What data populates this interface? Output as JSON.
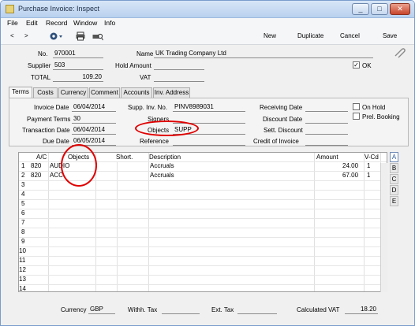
{
  "window": {
    "title": "Purchase Invoice: Inspect",
    "buttons": [
      "_",
      "□",
      "✕"
    ]
  },
  "menu": [
    "File",
    "Edit",
    "Record",
    "Window",
    "Info"
  ],
  "toolbar": {
    "prev": "<",
    "next": ">",
    "new": "New",
    "duplicate": "Duplicate",
    "cancel": "Cancel",
    "save": "Save"
  },
  "header": {
    "no_label": "No.",
    "no_value": "970001",
    "name_label": "Name",
    "name_value": "UK Trading Company Ltd",
    "supplier_label": "Supplier",
    "supplier_value": "503",
    "hold_label": "Hold Amount",
    "hold_value": "",
    "ok_label": "OK",
    "ok_checked": "✓",
    "total_label": "TOTAL",
    "total_value": "109.20",
    "vat_label": "VAT",
    "vat_value": ""
  },
  "tabs": [
    "Terms",
    "Costs",
    "Currency",
    "Comment",
    "Accounts",
    "Inv. Address"
  ],
  "terms": {
    "invoice_date_label": "Invoice Date",
    "invoice_date": "06/04/2014",
    "supp_inv_no_label": "Supp. Inv. No.",
    "supp_inv_no": "PINV8989031",
    "receiving_date_label": "Receiving Date",
    "receiving_date": "",
    "on_hold_label": "On Hold",
    "payment_terms_label": "Payment Terms",
    "payment_terms": "30",
    "signers_label": "Signers",
    "signers": "",
    "discount_date_label": "Discount Date",
    "discount_date": "",
    "prel_booking_label": "Prel. Booking",
    "transaction_date_label": "Transaction Date",
    "transaction_date": "06/04/2014",
    "objects_label": "Objects",
    "objects": "SUPP",
    "sett_discount_label": "Sett. Discount",
    "sett_discount": "",
    "due_date_label": "Due Date",
    "due_date": "06/05/2014",
    "reference_label": "Reference",
    "reference": "",
    "credit_label": "Credit of Invoice",
    "credit": ""
  },
  "grid": {
    "columns": [
      "A/C",
      "Objects",
      "Short.",
      "Description",
      "Amount",
      "V-Cd"
    ],
    "rows": [
      {
        "n": "1",
        "ac": "820",
        "objects": "AUDIO",
        "short": "",
        "desc": "Accruals",
        "amount": "24.00",
        "vcd": "1"
      },
      {
        "n": "2",
        "ac": "820",
        "objects": "ACC",
        "short": "",
        "desc": "Accruals",
        "amount": "67.00",
        "vcd": "1"
      }
    ],
    "row_numbers": [
      "1",
      "2",
      "3",
      "4",
      "5",
      "6",
      "7",
      "8",
      "9",
      "10",
      "11",
      "12",
      "13",
      "14"
    ],
    "side_tabs": [
      "A",
      "B",
      "C",
      "D",
      "E"
    ]
  },
  "footer": {
    "currency_label": "Currency",
    "currency": "GBP",
    "withh_tax_label": "Withh. Tax",
    "withh_tax": "",
    "ext_tax_label": "Ext. Tax",
    "ext_tax": "",
    "calc_vat_label": "Calculated VAT",
    "calc_vat": "18.20"
  },
  "colors": {
    "highlight_circle": "#e00000",
    "title_bg": "#c6daf2"
  }
}
